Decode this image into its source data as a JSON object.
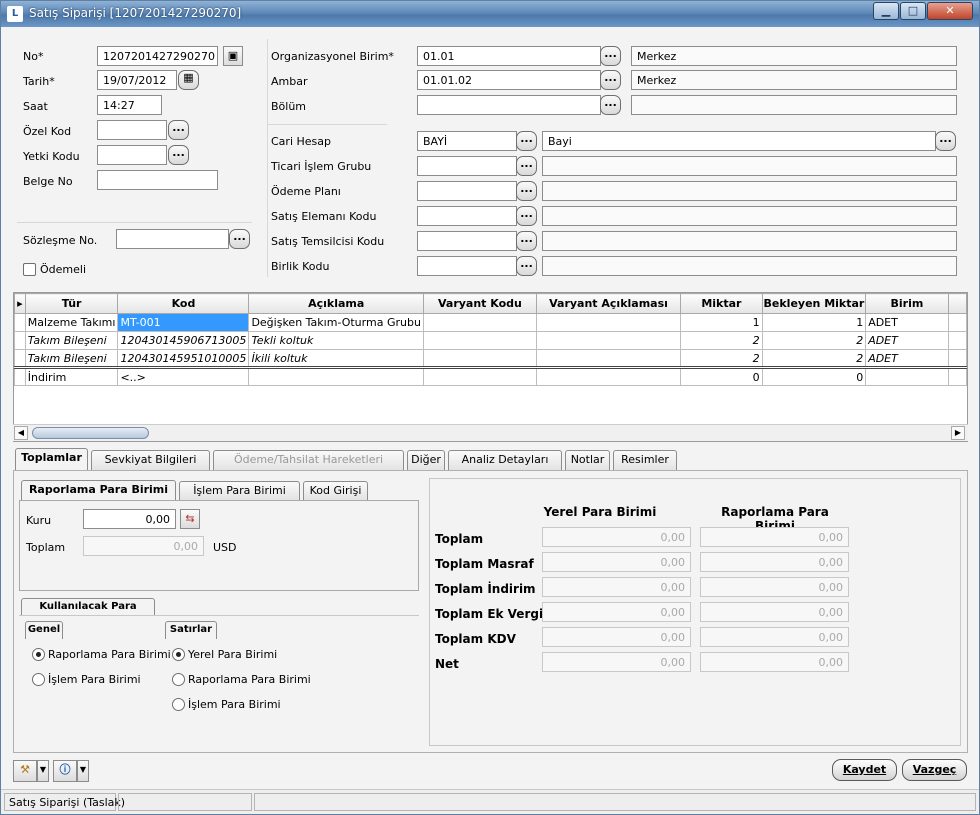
{
  "window": {
    "title": "Satış Siparişi [1207201427290270]",
    "min": "▁",
    "max": "□",
    "close": "✕"
  },
  "left": {
    "no_label": "No*",
    "no_value": "1207201427290270",
    "tarih_label": "Tarih*",
    "tarih_value": "19/07/2012",
    "saat_label": "Saat",
    "saat_value": "14:27",
    "ozelkod_label": "Özel Kod",
    "yetki_label": "Yetki Kodu",
    "belge_label": "Belge No",
    "sozlesme_label": "Sözleşme No.",
    "odemeli_label": "Ödemeli"
  },
  "right": {
    "org_label": "Organizasyonel Birim*",
    "org_code": "01.01",
    "org_name": "Merkez",
    "ambar_label": "Ambar",
    "ambar_code": "01.01.02",
    "ambar_name": "Merkez",
    "bolum_label": "Bölüm",
    "cari_label": "Cari Hesap",
    "cari_code": "BAYİ",
    "cari_name": "Bayi",
    "ticari_label": "Ticari İşlem Grubu",
    "odeme_label": "Ödeme Planı",
    "satis_el_label": "Satış Elemanı Kodu",
    "satis_tem_label": "Satış Temsilcisi Kodu",
    "birlik_label": "Birlik Kodu"
  },
  "dots": "...",
  "grid": {
    "columns": [
      "Tür",
      "Kod",
      "Açıklama",
      "Varyant Kodu",
      "Varyant Açıklaması",
      "Miktar",
      "Bekleyen Miktar",
      "Birim"
    ],
    "rows": [
      [
        "Malzeme Takımı",
        "MT-001",
        "Değişken Takım-Oturma Grubu",
        "",
        "",
        "1",
        "1",
        "ADET"
      ],
      [
        "Takım Bileşeni",
        "120430145906713005",
        "Tekli koltuk",
        "",
        "",
        "2",
        "2",
        "ADET"
      ],
      [
        "Takım Bileşeni",
        "120430145951010005",
        "İkili koltuk",
        "",
        "",
        "2",
        "2",
        "ADET"
      ]
    ],
    "discount_row": [
      "İndirim",
      "<..>",
      "",
      "",
      "",
      "0",
      "0",
      ""
    ]
  },
  "tabs": [
    "Toplamlar",
    "Sevkiyat Bilgileri",
    "Ödeme/Tahsilat Hareketleri",
    "Diğer",
    "Analiz Detayları",
    "Notlar",
    "Resimler"
  ],
  "subtabs": [
    "Raporlama Para Birimi",
    "İşlem Para Birimi",
    "Kod Girişi"
  ],
  "kur": {
    "kuru_label": "Kuru",
    "kuru_value": "0,00",
    "toplam_label": "Toplam",
    "toplam_value": "0,00",
    "currency": "USD"
  },
  "para": {
    "title": "Kullanılacak Para Birimi",
    "genel_title": "Genel",
    "genel_opts": [
      "Raporlama Para Birimi",
      "İşlem Para Birimi"
    ],
    "satirlar_title": "Satırlar",
    "satirlar_opts": [
      "Yerel Para Birimi",
      "Raporlama Para Birimi",
      "İşlem Para Birimi"
    ]
  },
  "totals": {
    "col1": "Yerel Para Birimi",
    "col2": "Raporlama Para Birimi",
    "rows": [
      {
        "label": "Toplam",
        "v1": "0,00",
        "v2": "0,00"
      },
      {
        "label": "Toplam Masraf",
        "v1": "0,00",
        "v2": "0,00"
      },
      {
        "label": "Toplam İndirim",
        "v1": "0,00",
        "v2": "0,00"
      },
      {
        "label": "Toplam Ek Vergi",
        "v1": "0,00",
        "v2": "0,00"
      },
      {
        "label": "Toplam KDV",
        "v1": "0,00",
        "v2": "0,00"
      },
      {
        "label": "Net",
        "v1": "0,00",
        "v2": "0,00"
      }
    ]
  },
  "buttons": {
    "save": "Kaydet",
    "cancel": "Vazgeç"
  },
  "status": {
    "text": "Satış Siparişi (Taslak)"
  }
}
